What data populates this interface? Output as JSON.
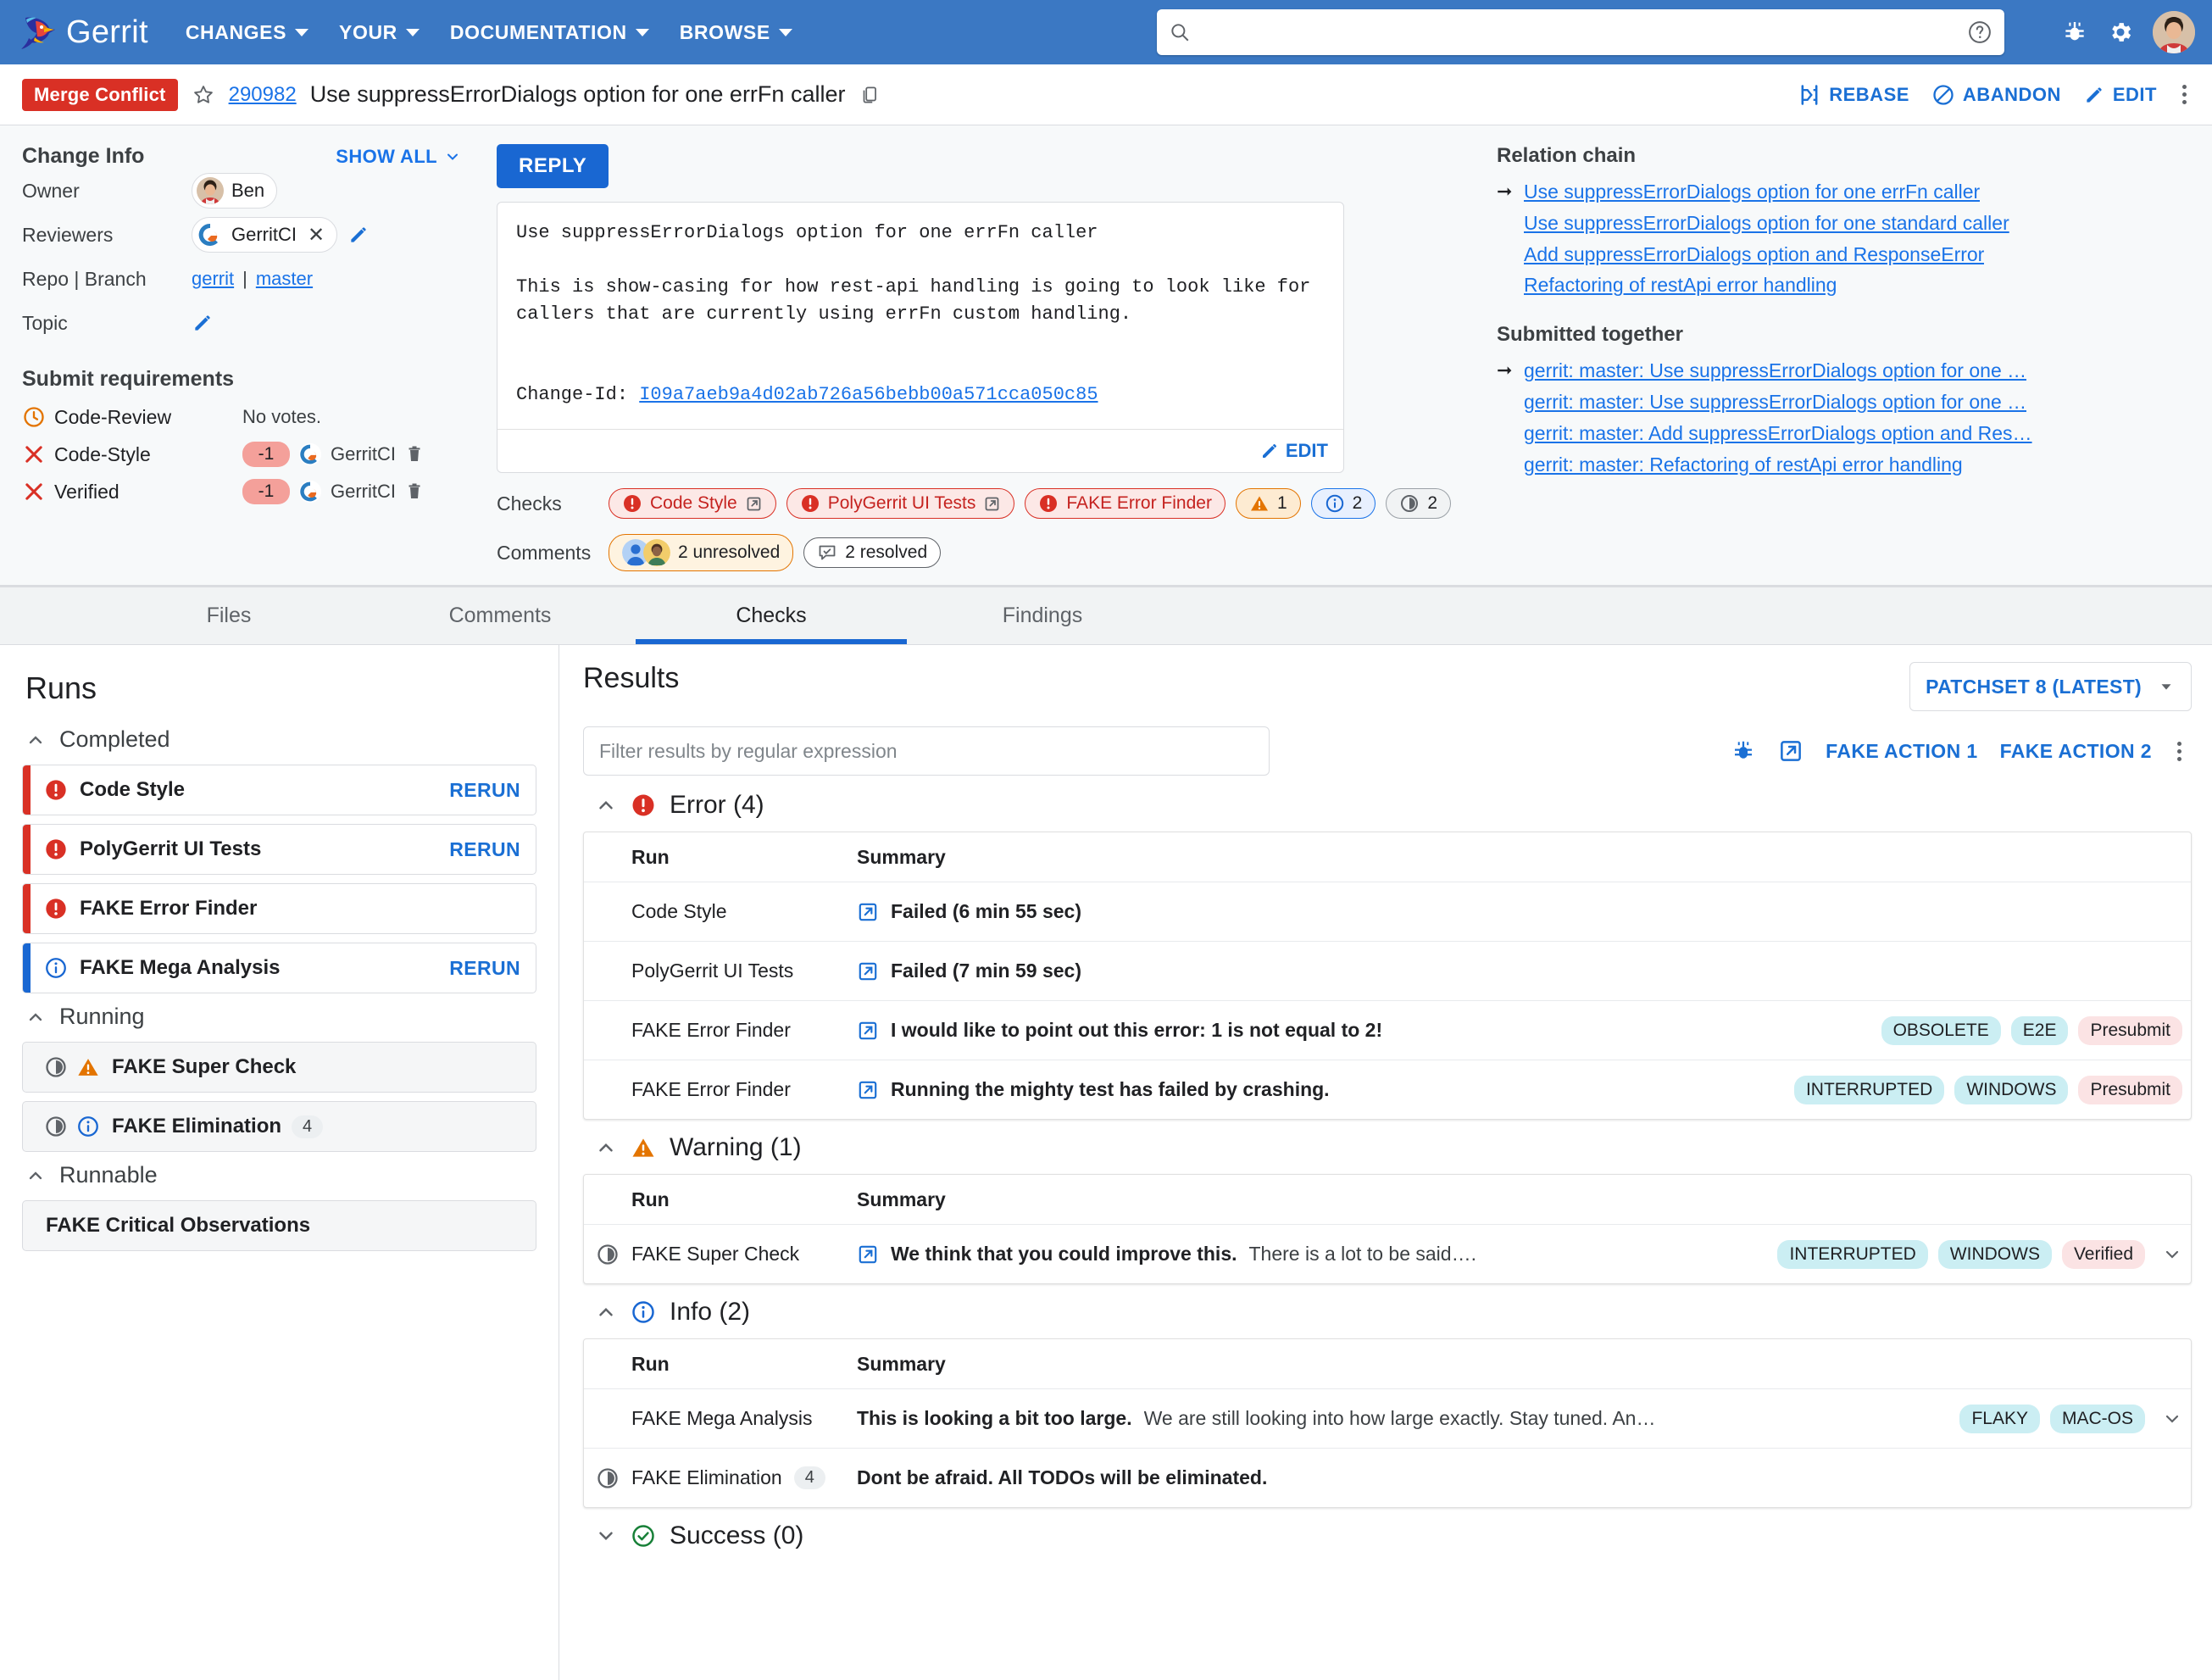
{
  "topnav": {
    "brand": "Gerrit",
    "items": [
      {
        "label": "CHANGES"
      },
      {
        "label": "YOUR"
      },
      {
        "label": "DOCUMENTATION"
      },
      {
        "label": "BROWSE"
      }
    ],
    "search_placeholder": "",
    "search_value": ""
  },
  "change_header": {
    "status_badge": "Merge Conflict",
    "change_number": "290982",
    "title": "Use suppressErrorDialogs option for one errFn caller",
    "actions": [
      {
        "label": "REBASE",
        "icon": "rebase-icon"
      },
      {
        "label": "ABANDON",
        "icon": "abandon-icon"
      },
      {
        "label": "EDIT",
        "icon": "pencil-icon"
      }
    ]
  },
  "change_info": {
    "title": "Change Info",
    "show_all": "SHOW ALL",
    "owner_label": "Owner",
    "owner_name": "Ben",
    "reviewers_label": "Reviewers",
    "reviewer_name": "GerritCI",
    "repo_branch_label": "Repo | Branch",
    "repo": "gerrit",
    "branch": "master",
    "separator": "|",
    "topic_label": "Topic",
    "submit_requirements_title": "Submit requirements",
    "requirements": [
      {
        "name": "Code-Review",
        "status": "pending",
        "value": "",
        "voter": "",
        "detail": "No votes."
      },
      {
        "name": "Code-Style",
        "status": "fail",
        "value": "-1",
        "voter": "GerritCI",
        "detail": ""
      },
      {
        "name": "Verified",
        "status": "fail",
        "value": "-1",
        "voter": "GerritCI",
        "detail": ""
      }
    ]
  },
  "commit": {
    "reply_label": "REPLY",
    "message": "Use suppressErrorDialogs option for one errFn caller\n\nThis is show-casing for how rest-api handling is going to look like for\ncallers that are currently using errFn custom handling.\n\n\nChange-Id: ",
    "change_id_label": "Change-Id: ",
    "change_id": "I09a7aeb9a4d02ab726a56bebb00a571cca050c85",
    "edit_label": "EDIT",
    "checks_label": "Checks",
    "comments_label": "Comments",
    "checks_chips": [
      {
        "label": "Code Style",
        "kind": "error",
        "external": true
      },
      {
        "label": "PolyGerrit UI Tests",
        "kind": "error",
        "external": true
      },
      {
        "label": "FAKE Error Finder",
        "kind": "error",
        "external": false
      },
      {
        "label": "1",
        "kind": "warn",
        "external": false
      },
      {
        "label": "2",
        "kind": "info",
        "external": false
      },
      {
        "label": "2",
        "kind": "gray",
        "external": false
      }
    ],
    "comment_chips": [
      {
        "label": "2 unresolved",
        "kind": "unres"
      },
      {
        "label": "2 resolved",
        "kind": "res"
      }
    ]
  },
  "relation": {
    "chain_title": "Relation chain",
    "chain_items": [
      {
        "text": "Use suppressErrorDialogs option for one errFn caller",
        "current": true
      },
      {
        "text": "Use suppressErrorDialogs option for one standard caller",
        "current": false
      },
      {
        "text": "Add suppressErrorDialogs option and ResponseError",
        "current": false
      },
      {
        "text": "Refactoring of restApi error handling",
        "current": false
      }
    ],
    "together_title": "Submitted together",
    "together_items": [
      {
        "text": "gerrit: master: Use suppressErrorDialogs option for one …",
        "current": true
      },
      {
        "text": "gerrit: master: Use suppressErrorDialogs option for one …",
        "current": false
      },
      {
        "text": "gerrit: master: Add suppressErrorDialogs option and Res…",
        "current": false
      },
      {
        "text": "gerrit: master: Refactoring of restApi error handling",
        "current": false
      }
    ]
  },
  "tabs": [
    {
      "label": "Files",
      "active": false
    },
    {
      "label": "Comments",
      "active": false
    },
    {
      "label": "Checks",
      "active": true
    },
    {
      "label": "Findings",
      "active": false
    }
  ],
  "runs": {
    "title": "Runs",
    "groups": [
      {
        "name": "Completed",
        "items": [
          {
            "label": "Code Style",
            "status": "error",
            "action": "RERUN",
            "count": "",
            "running": false
          },
          {
            "label": "PolyGerrit UI Tests",
            "status": "error",
            "action": "RERUN",
            "count": "",
            "running": false
          },
          {
            "label": "FAKE Error Finder",
            "status": "error",
            "action": "",
            "count": "",
            "running": false
          },
          {
            "label": "FAKE Mega Analysis",
            "status": "info",
            "action": "RERUN",
            "count": "",
            "running": false
          }
        ]
      },
      {
        "name": "Running",
        "items": [
          {
            "label": "FAKE Super Check",
            "status": "warning",
            "action": "",
            "count": "",
            "running": true
          },
          {
            "label": "FAKE Elimination",
            "status": "info",
            "action": "",
            "count": "4",
            "running": true
          }
        ]
      },
      {
        "name": "Runnable",
        "items": [
          {
            "label": "FAKE Critical Observations",
            "status": "none",
            "action": "",
            "count": "",
            "running": false
          }
        ]
      }
    ]
  },
  "results": {
    "title": "Results",
    "patchset_label": "PATCHSET 8 (LATEST)",
    "filter_placeholder": "Filter results by regular expression",
    "filter_value": "",
    "actions": [
      {
        "label": "FAKE ACTION 1"
      },
      {
        "label": "FAKE ACTION 2"
      }
    ],
    "columns": {
      "run": "Run",
      "summary": "Summary"
    },
    "sections": [
      {
        "name": "Error",
        "count": "4",
        "label": "Error (4)",
        "kind": "error",
        "expanded": true,
        "rows": [
          {
            "run": "Code Style",
            "summary_strong": "Failed (6 min 55 sec)",
            "summary_rest": "",
            "external": true,
            "status_icon": "",
            "count": "",
            "tags": [],
            "chevron": false
          },
          {
            "run": "PolyGerrit UI Tests",
            "summary_strong": "Failed (7 min 59 sec)",
            "summary_rest": "",
            "external": true,
            "status_icon": "",
            "count": "",
            "tags": [],
            "chevron": false
          },
          {
            "run": "FAKE Error Finder",
            "summary_strong": "I would like to point out this error: 1 is not equal to 2!",
            "summary_rest": "",
            "external": true,
            "status_icon": "",
            "count": "",
            "tags": [
              {
                "label": "OBSOLETE",
                "kind": "cyan"
              },
              {
                "label": "E2E",
                "kind": "cyan"
              },
              {
                "label": "Presubmit",
                "kind": "pink"
              }
            ],
            "chevron": false
          },
          {
            "run": "FAKE Error Finder",
            "summary_strong": "Running the mighty test has failed by crashing.",
            "summary_rest": "",
            "external": true,
            "status_icon": "",
            "count": "",
            "tags": [
              {
                "label": "INTERRUPTED",
                "kind": "cyan"
              },
              {
                "label": "WINDOWS",
                "kind": "cyan"
              },
              {
                "label": "Presubmit",
                "kind": "pink"
              }
            ],
            "chevron": false
          }
        ]
      },
      {
        "name": "Warning",
        "count": "1",
        "label": "Warning (1)",
        "kind": "warning",
        "expanded": true,
        "rows": [
          {
            "run": "FAKE Super Check",
            "summary_strong": "We think that you could improve this.",
            "summary_rest": "There is a lot to be said….",
            "external": true,
            "status_icon": "running",
            "count": "",
            "tags": [
              {
                "label": "INTERRUPTED",
                "kind": "cyan"
              },
              {
                "label": "WINDOWS",
                "kind": "cyan"
              },
              {
                "label": "Verified",
                "kind": "pink"
              }
            ],
            "chevron": true
          }
        ]
      },
      {
        "name": "Info",
        "count": "2",
        "label": "Info (2)",
        "kind": "info",
        "expanded": true,
        "rows": [
          {
            "run": "FAKE Mega Analysis",
            "summary_strong": "This is looking a bit too large.",
            "summary_rest": "We are still looking into how large exactly. Stay tuned. An…",
            "external": false,
            "status_icon": "",
            "count": "",
            "tags": [
              {
                "label": "FLAKY",
                "kind": "cyan"
              },
              {
                "label": "MAC-OS",
                "kind": "cyan"
              }
            ],
            "chevron": true
          },
          {
            "run": "FAKE Elimination",
            "summary_strong": "Dont be afraid. All TODOs will be eliminated.",
            "summary_rest": "",
            "external": false,
            "status_icon": "running",
            "count": "4",
            "tags": [],
            "chevron": false
          }
        ]
      },
      {
        "name": "Success",
        "count": "0",
        "label": "Success (0)",
        "kind": "success",
        "expanded": false,
        "rows": []
      }
    ]
  },
  "colors": {
    "brand_blue": "#3b78c3",
    "link_blue": "#1a73e8",
    "error_red": "#d93025",
    "warning_orange": "#e37400",
    "info_blue": "#1967d2",
    "success_green": "#188038",
    "tag_cyan": "#cbeef3",
    "tag_pink": "#fbe3e4",
    "vote_negative": "#f4a09a"
  }
}
